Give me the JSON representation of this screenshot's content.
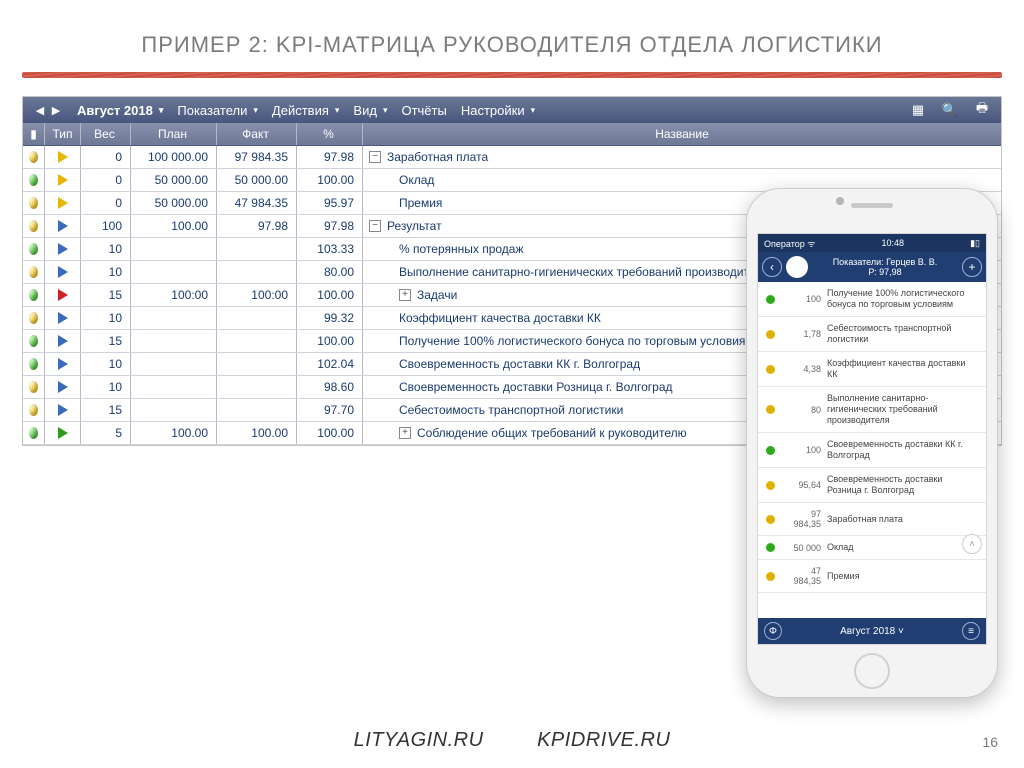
{
  "slide": {
    "title": "ПРИМЕР 2:  KPI-МАТРИЦА РУКОВОДИТЕЛЯ ОТДЕЛА ЛОГИСТИКИ",
    "page": "16"
  },
  "footer": {
    "link1": "LITYAGIN.RU",
    "link2": "KPIDRIVE.RU"
  },
  "menubar": {
    "period": "Август 2018",
    "items": [
      "Показатели",
      "Действия",
      "Вид",
      "Отчёты",
      "Настройки"
    ]
  },
  "headers": {
    "type": "Тип",
    "weight": "Вес",
    "plan": "План",
    "fact": "Факт",
    "pct": "%",
    "name": "Название"
  },
  "rows": [
    {
      "light": "yellow",
      "type": "yellow",
      "weight": "0",
      "plan": "100 000.00",
      "fact": "97 984.35",
      "pct": "97.98",
      "name": "Заработная плата",
      "exp": "−",
      "indent": 0
    },
    {
      "light": "green",
      "type": "yellow",
      "weight": "0",
      "plan": "50 000.00",
      "fact": "50 000.00",
      "pct": "100.00",
      "name": "Оклад",
      "indent": 1
    },
    {
      "light": "yellow",
      "type": "yellow",
      "weight": "0",
      "plan": "50 000.00",
      "fact": "47 984.35",
      "pct": "95.97",
      "name": "Премия",
      "indent": 1
    },
    {
      "light": "yellow",
      "type": "blue",
      "weight": "100",
      "plan": "100.00",
      "fact": "97.98",
      "pct": "97.98",
      "name": "Результат",
      "exp": "−",
      "indent": 0
    },
    {
      "light": "green",
      "type": "blue",
      "weight": "10",
      "plan": "",
      "fact": "",
      "pct": "103.33",
      "name": "% потерянных продаж",
      "indent": 1
    },
    {
      "light": "yellow",
      "type": "blue",
      "weight": "10",
      "plan": "",
      "fact": "",
      "pct": "80.00",
      "name": "Выполнение санитарно-гигиенических требований производителя",
      "indent": 1
    },
    {
      "light": "green",
      "type": "red",
      "weight": "15",
      "plan": "100:00",
      "fact": "100:00",
      "pct": "100.00",
      "name": "Задачи",
      "exp": "+",
      "indent": 1
    },
    {
      "light": "yellow",
      "type": "blue",
      "weight": "10",
      "plan": "",
      "fact": "",
      "pct": "99.32",
      "name": "Коэффициент качества доставки КК",
      "indent": 1
    },
    {
      "light": "green",
      "type": "blue",
      "weight": "15",
      "plan": "",
      "fact": "",
      "pct": "100.00",
      "name": "Получение 100% логистического бонуса по торговым условиям",
      "indent": 1
    },
    {
      "light": "green",
      "type": "blue",
      "weight": "10",
      "plan": "",
      "fact": "",
      "pct": "102.04",
      "name": "Своевременность доставки КК г. Волгоград",
      "indent": 1
    },
    {
      "light": "yellow",
      "type": "blue",
      "weight": "10",
      "plan": "",
      "fact": "",
      "pct": "98.60",
      "name": "Своевременность доставки Розница г. Волгоград",
      "indent": 1
    },
    {
      "light": "yellow",
      "type": "blue",
      "weight": "15",
      "plan": "",
      "fact": "",
      "pct": "97.70",
      "name": "Себестоимость транспортной логистики",
      "indent": 1
    },
    {
      "light": "green",
      "type": "green",
      "weight": "5",
      "plan": "100.00",
      "fact": "100.00",
      "pct": "100.00",
      "name": "Соблюдение общих требований к руководителю",
      "exp": "+",
      "indent": 1
    }
  ],
  "phone": {
    "status": {
      "operator": "Оператор",
      "time": "10:48"
    },
    "appbar": {
      "title1": "Показатели: Герцев В. В.",
      "title2": "Р: 97,98"
    },
    "items": [
      {
        "color": "g",
        "val": "100",
        "label": "Получение 100% логистического бонуса по торговым условиям"
      },
      {
        "color": "y",
        "val": "1,78",
        "label": "Себестоимость транспортной логистики"
      },
      {
        "color": "y",
        "val": "4,38",
        "label": "Коэффициент качества доставки КК"
      },
      {
        "color": "y",
        "val": "80",
        "label": "Выполнение санитарно-гигиенических требований производителя"
      },
      {
        "color": "g",
        "val": "100",
        "label": "Своевременность доставки КК г. Волгоград"
      },
      {
        "color": "y",
        "val": "95,64",
        "label": "Своевременность доставки Розница г. Волгоград"
      },
      {
        "color": "y",
        "val": "97 984,35",
        "label": "Заработная плата"
      },
      {
        "color": "g",
        "val": "50 000",
        "label": "Оклад"
      },
      {
        "color": "y",
        "val": "47 984,35",
        "label": "Премия"
      }
    ],
    "footer": "Август 2018"
  }
}
